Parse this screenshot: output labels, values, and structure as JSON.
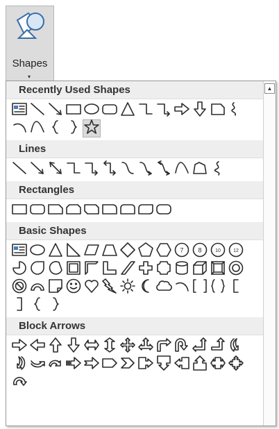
{
  "ribbon": {
    "shapes_label": "Shapes",
    "dropdown_arrow": "▾",
    "scroll_up_arrow": "▲"
  },
  "colors": {
    "panel_border": "#9a9a9a",
    "header_bg": "#eeeeee",
    "button_bg": "#dcdcdc"
  },
  "sections": [
    {
      "key": "recent",
      "title": "Recently Used Shapes",
      "shapes": [
        "textbox",
        "line",
        "arrow-line",
        "rectangle",
        "oval",
        "rounded-rectangle",
        "triangle",
        "elbow-connector",
        "elbow-arrow-connector",
        "right-arrow",
        "down-arrow",
        "snip-rectangle",
        "freeform-scribble",
        "arc",
        "curve",
        "left-brace",
        "right-brace",
        "star"
      ]
    },
    {
      "key": "lines",
      "title": "Lines",
      "shapes": [
        "line",
        "arrow-line",
        "double-arrow-line",
        "elbow-connector",
        "elbow-arrow-connector",
        "elbow-double-arrow-connector",
        "curved-connector",
        "curved-arrow-connector",
        "curved-double-arrow-connector",
        "curve",
        "freeform",
        "scribble"
      ]
    },
    {
      "key": "rectangles",
      "title": "Rectangles",
      "shapes": [
        "rectangle",
        "rounded-rectangle",
        "snip-single-corner",
        "snip-same-side",
        "snip-diagonal",
        "round-single-corner",
        "round-same-side",
        "round-diagonal",
        "rounded-rect-2"
      ]
    },
    {
      "key": "basic",
      "title": "Basic Shapes",
      "shapes": [
        "textbox",
        "oval",
        "triangle",
        "right-triangle",
        "parallelogram",
        "trapezoid",
        "diamond",
        "pentagon",
        "hexagon",
        "heptagon",
        "octagon",
        "decagon",
        "dodecagon",
        "pie",
        "teardrop",
        "chord",
        "frame",
        "half-frame",
        "l-shape",
        "diagonal-stripe",
        "cross",
        "plaque",
        "can",
        "cube",
        "bevel",
        "donut",
        "no-symbol",
        "block-arc",
        "folded-corner",
        "smiley",
        "heart",
        "lightning",
        "sun",
        "moon",
        "cloud",
        "arc",
        "double-bracket",
        "double-brace",
        "left-bracket",
        "right-bracket",
        "left-brace",
        "right-brace"
      ]
    },
    {
      "key": "block",
      "title": "Block Arrows",
      "shapes": [
        "right-arrow",
        "left-arrow",
        "up-arrow",
        "down-arrow",
        "left-right-arrow",
        "up-down-arrow",
        "quad-arrow",
        "left-right-up-arrow",
        "bent-arrow",
        "u-turn-arrow",
        "left-up-arrow",
        "bent-up-arrow",
        "curved-right-arrow",
        "curved-left-arrow",
        "curved-up-arrow",
        "curved-down-arrow",
        "striped-right-arrow",
        "notched-right-arrow",
        "pentagon-arrow",
        "chevron",
        "right-arrow-callout",
        "down-arrow-callout",
        "left-arrow-callout",
        "up-arrow-callout",
        "left-right-arrow-callout",
        "quad-arrow-callout",
        "circular-arrow"
      ]
    }
  ]
}
